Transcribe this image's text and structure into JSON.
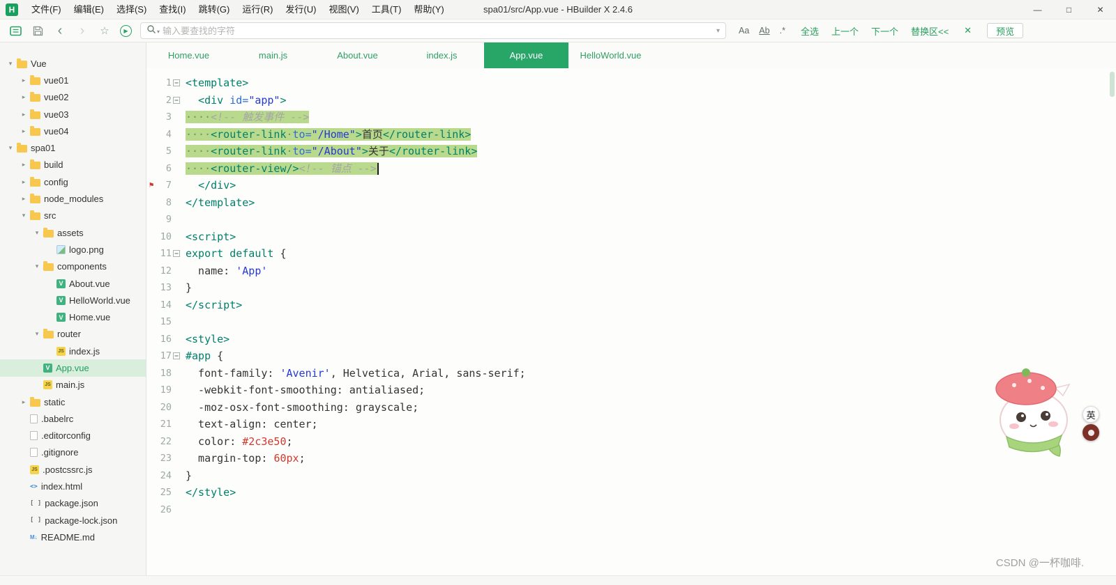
{
  "titlebar": {
    "logo_letter": "H",
    "title": "spa01/src/App.vue - HBuilder X 2.4.6",
    "window_controls": [
      {
        "name": "minimize-button",
        "glyph": "—"
      },
      {
        "name": "maximize-button",
        "glyph": "□"
      },
      {
        "name": "close-button",
        "glyph": "✕"
      }
    ]
  },
  "menubar": {
    "items": [
      "文件(F)",
      "编辑(E)",
      "选择(S)",
      "查找(I)",
      "跳转(G)",
      "运行(R)",
      "发行(U)",
      "视图(V)",
      "工具(T)",
      "帮助(Y)"
    ]
  },
  "icons": {
    "back": "‹",
    "forward": "›",
    "star": "☆",
    "play": "▶",
    "caret_small": "▾",
    "caret": "▾"
  },
  "toolbar": {
    "search_placeholder": "输入要查找的字符",
    "match_options": [
      {
        "name": "match-case-button",
        "label": "Aa"
      },
      {
        "name": "whole-word-button",
        "label": "Ab"
      },
      {
        "name": "regex-button",
        "label": ".*"
      }
    ],
    "find_actions": [
      {
        "name": "select-all-matches-button",
        "label": "全选"
      },
      {
        "name": "find-previous-button",
        "label": "上一个"
      },
      {
        "name": "find-next-button",
        "label": "下一个"
      },
      {
        "name": "toggle-replace-button",
        "label": "替换区<<"
      }
    ],
    "close_find_glyph": "✕",
    "preview_label": "预览"
  },
  "tabs": [
    {
      "label": "Home.vue",
      "active": false
    },
    {
      "label": "main.js",
      "active": false
    },
    {
      "label": "About.vue",
      "active": false
    },
    {
      "label": "index.js",
      "active": false
    },
    {
      "label": "App.vue",
      "active": true
    },
    {
      "label": "HelloWorld.vue",
      "active": false
    }
  ],
  "file_tree": [
    {
      "label": "Vue",
      "level": 0,
      "icon": "folder",
      "state": "expanded"
    },
    {
      "label": "vue01",
      "level": 1,
      "icon": "folder",
      "state": "collapsed"
    },
    {
      "label": "vue02",
      "level": 1,
      "icon": "folder",
      "state": "collapsed"
    },
    {
      "label": "vue03",
      "level": 1,
      "icon": "folder",
      "state": "collapsed"
    },
    {
      "label": "vue04",
      "level": 1,
      "icon": "folder",
      "state": "collapsed"
    },
    {
      "label": "spa01",
      "level": 0,
      "icon": "folder",
      "state": "expanded"
    },
    {
      "label": "build",
      "level": 1,
      "icon": "folder",
      "state": "collapsed"
    },
    {
      "label": "config",
      "level": 1,
      "icon": "folder",
      "state": "collapsed"
    },
    {
      "label": "node_modules",
      "level": 1,
      "icon": "folder",
      "state": "collapsed"
    },
    {
      "label": "src",
      "level": 1,
      "icon": "folder",
      "state": "expanded"
    },
    {
      "label": "assets",
      "level": 2,
      "icon": "folder",
      "state": "expanded"
    },
    {
      "label": "logo.png",
      "level": 3,
      "icon": "png"
    },
    {
      "label": "components",
      "level": 2,
      "icon": "folder",
      "state": "expanded"
    },
    {
      "label": "About.vue",
      "level": 3,
      "icon": "vue"
    },
    {
      "label": "HelloWorld.vue",
      "level": 3,
      "icon": "vue"
    },
    {
      "label": "Home.vue",
      "level": 3,
      "icon": "vue"
    },
    {
      "label": "router",
      "level": 2,
      "icon": "folder",
      "state": "expanded"
    },
    {
      "label": "index.js",
      "level": 3,
      "icon": "js"
    },
    {
      "label": "App.vue",
      "level": 2,
      "icon": "vue",
      "selected": true
    },
    {
      "label": "main.js",
      "level": 2,
      "icon": "js"
    },
    {
      "label": "static",
      "level": 1,
      "icon": "folder",
      "state": "collapsed"
    },
    {
      "label": ".babelrc",
      "level": 1,
      "icon": "file"
    },
    {
      "label": ".editorconfig",
      "level": 1,
      "icon": "file"
    },
    {
      "label": ".gitignore",
      "level": 1,
      "icon": "file"
    },
    {
      "label": ".postcssrc.js",
      "level": 1,
      "icon": "js"
    },
    {
      "label": "index.html",
      "level": 1,
      "icon": "html"
    },
    {
      "label": "package.json",
      "level": 1,
      "icon": "json"
    },
    {
      "label": "package-lock.json",
      "level": 1,
      "icon": "json"
    },
    {
      "label": "README.md",
      "level": 1,
      "icon": "md"
    }
  ],
  "editor": {
    "bookmark_line": 7,
    "lines": [
      {
        "n": 1,
        "fold": true,
        "tok": [
          [
            "g",
            "<template>"
          ]
        ]
      },
      {
        "n": 2,
        "fold": true,
        "tok": [
          [
            "t",
            "  "
          ],
          [
            "g",
            "<div"
          ],
          [
            "t",
            " "
          ],
          [
            "a",
            "id="
          ],
          [
            "s",
            "\"app\""
          ],
          [
            "g",
            ">"
          ]
        ]
      },
      {
        "n": 3,
        "sel": true,
        "tok": [
          [
            "w",
            "····"
          ],
          [
            "c",
            "<!-- 触发事件 -->"
          ]
        ]
      },
      {
        "n": 4,
        "sel": true,
        "tok": [
          [
            "w",
            "····"
          ],
          [
            "g",
            "<router-link"
          ],
          [
            "w",
            "·"
          ],
          [
            "a",
            "to="
          ],
          [
            "s",
            "\"/Home\""
          ],
          [
            "g",
            ">"
          ],
          [
            "t",
            "首页"
          ],
          [
            "g",
            "</router-link>"
          ]
        ]
      },
      {
        "n": 5,
        "sel": true,
        "tok": [
          [
            "w",
            "····"
          ],
          [
            "g",
            "<router-link"
          ],
          [
            "w",
            "·"
          ],
          [
            "a",
            "to="
          ],
          [
            "s",
            "\"/About\""
          ],
          [
            "g",
            ">"
          ],
          [
            "t",
            "关于"
          ],
          [
            "g",
            "</router-link>"
          ]
        ]
      },
      {
        "n": 6,
        "sel": true,
        "cursor": true,
        "tok": [
          [
            "w",
            "····"
          ],
          [
            "g",
            "<router-view/>"
          ],
          [
            "c",
            "<!-- 锚点 -->"
          ]
        ]
      },
      {
        "n": 7,
        "bookmark": true,
        "tok": [
          [
            "t",
            "  "
          ],
          [
            "g",
            "</div>"
          ]
        ]
      },
      {
        "n": 8,
        "tok": [
          [
            "g",
            "</template>"
          ]
        ]
      },
      {
        "n": 9,
        "tok": []
      },
      {
        "n": 10,
        "tok": [
          [
            "g",
            "<script>"
          ]
        ]
      },
      {
        "n": 11,
        "fold": true,
        "tok": [
          [
            "k",
            "export default"
          ],
          [
            "t",
            " {"
          ]
        ]
      },
      {
        "n": 12,
        "tok": [
          [
            "t",
            "  name: "
          ],
          [
            "s",
            "'App'"
          ]
        ]
      },
      {
        "n": 13,
        "tok": [
          [
            "t",
            "}"
          ]
        ]
      },
      {
        "n": 14,
        "tok": [
          [
            "g",
            "</script>"
          ]
        ]
      },
      {
        "n": 15,
        "tok": []
      },
      {
        "n": 16,
        "tok": [
          [
            "g",
            "<style>"
          ]
        ]
      },
      {
        "n": 17,
        "fold": true,
        "tok": [
          [
            "k",
            "#app"
          ],
          [
            "t",
            " {"
          ]
        ]
      },
      {
        "n": 18,
        "tok": [
          [
            "t",
            "  font-family: "
          ],
          [
            "s",
            "'Avenir'"
          ],
          [
            "t",
            ", Helvetica, Arial, sans-serif;"
          ]
        ]
      },
      {
        "n": 19,
        "tok": [
          [
            "t",
            "  -webkit-font-smoothing: antialiased;"
          ]
        ]
      },
      {
        "n": 20,
        "tok": [
          [
            "t",
            "  -moz-osx-font-smoothing: grayscale;"
          ]
        ]
      },
      {
        "n": 21,
        "tok": [
          [
            "t",
            "  text-align: center;"
          ]
        ]
      },
      {
        "n": 22,
        "tok": [
          [
            "t",
            "  color: "
          ],
          [
            "r",
            "#2c3e50"
          ],
          [
            "t",
            ";"
          ]
        ]
      },
      {
        "n": 23,
        "tok": [
          [
            "t",
            "  margin-top: "
          ],
          [
            "r",
            "60px"
          ],
          [
            "t",
            ";"
          ]
        ]
      },
      {
        "n": 24,
        "tok": [
          [
            "t",
            "}"
          ]
        ]
      },
      {
        "n": 25,
        "tok": [
          [
            "g",
            "</style>"
          ]
        ]
      },
      {
        "n": 26,
        "tok": []
      }
    ]
  },
  "overlays": {
    "watermark": "CSDN @一杯咖啡.",
    "badge_translate": "英"
  },
  "colors": {
    "accent_green": "#27a668",
    "tab_active_bg": "#27a668",
    "selection_highlight": "#b9da8c",
    "selected_tree_bg": "#d9eedd",
    "tag_color": "#00806b",
    "attribute_color": "#2e6bd6",
    "string_color": "#2439d4",
    "comment_color": "#a6a6a6",
    "value_red": "#d0392e",
    "bookmark_red": "#cc382c"
  }
}
